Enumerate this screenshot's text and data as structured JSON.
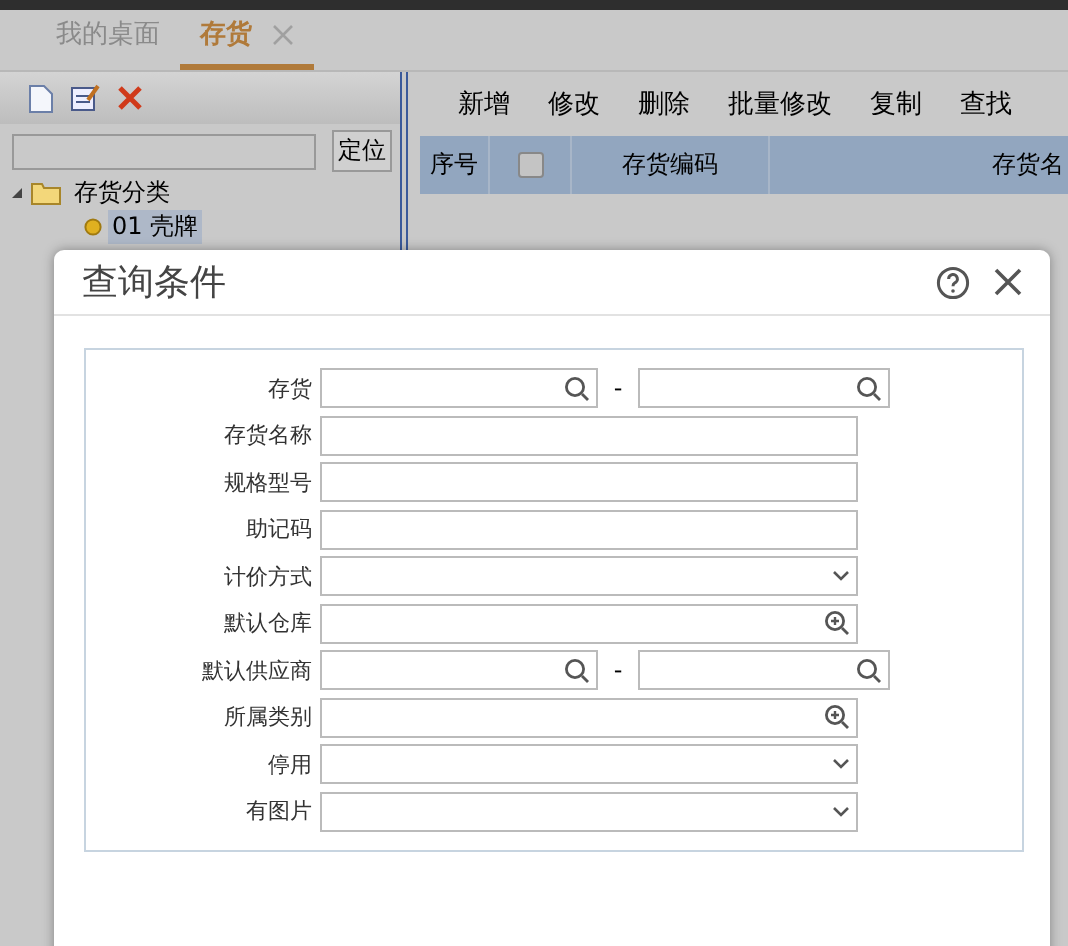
{
  "tabs": [
    {
      "label": "我的桌面",
      "selected": false,
      "closable": false
    },
    {
      "label": "存货",
      "selected": true,
      "closable": true
    }
  ],
  "left_panel": {
    "locate_button": "定位",
    "tree": [
      {
        "label": "存货分类",
        "expanded": true,
        "selected": false,
        "children": [
          {
            "label": "01 壳牌",
            "selected": true
          }
        ]
      }
    ]
  },
  "toolbar": [
    "新增",
    "修改",
    "删除",
    "批量修改",
    "复制",
    "查找"
  ],
  "table": {
    "columns": [
      {
        "kind": "text",
        "label": "序号"
      },
      {
        "kind": "checkbox",
        "checked": false
      },
      {
        "kind": "text",
        "label": "存货编码"
      },
      {
        "kind": "text",
        "label": "存货名"
      }
    ]
  },
  "dialog": {
    "title": "查询条件",
    "fields": [
      {
        "label": "存货",
        "kind": "range",
        "separator": "-"
      },
      {
        "label": "存货名称",
        "kind": "text"
      },
      {
        "label": "规格型号",
        "kind": "text"
      },
      {
        "label": "助记码",
        "kind": "text"
      },
      {
        "label": "计价方式",
        "kind": "select"
      },
      {
        "label": "默认仓库",
        "kind": "lookup"
      },
      {
        "label": "默认供应商",
        "kind": "range",
        "separator": "-"
      },
      {
        "label": "所属类别",
        "kind": "lookup"
      },
      {
        "label": "停用",
        "kind": "select"
      },
      {
        "label": "有图片",
        "kind": "select"
      }
    ]
  }
}
